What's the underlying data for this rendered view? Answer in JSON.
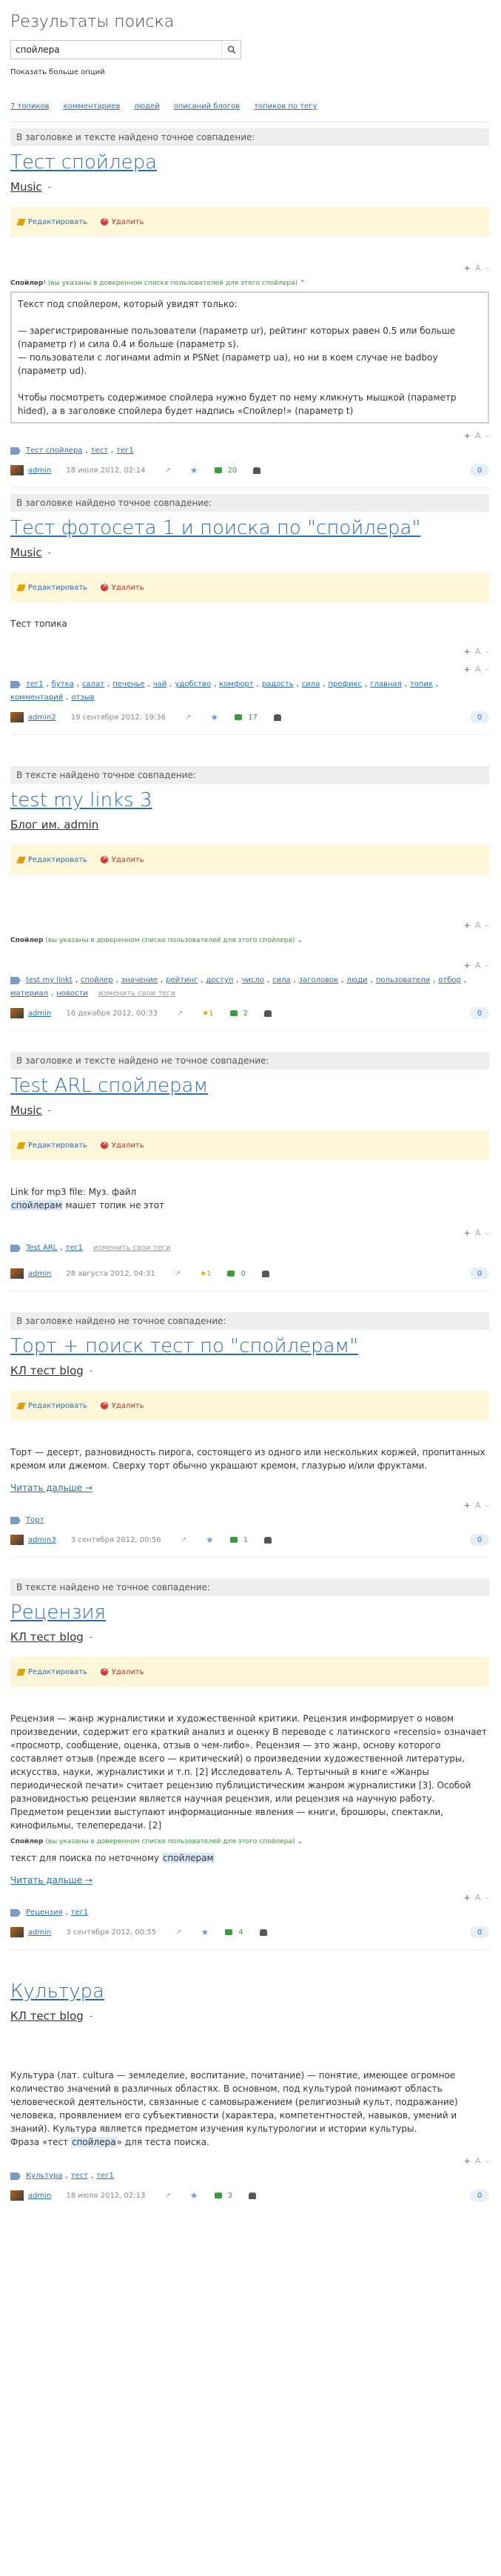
{
  "page": {
    "title": "Результаты поиска",
    "query": "спойлера",
    "more_options": "Показать больше опций",
    "filters": [
      "7 топиков",
      "комментариев",
      "людей",
      "описаний блогов",
      "топиков по тегу"
    ]
  },
  "topics": [
    {
      "match_note": "В заголовке и тексте найдено точное совпадение:",
      "title": "Тест спойлера",
      "blog": "Music",
      "edit": "Редактировать",
      "delete": "Удалить",
      "spoiler_note_prefix": "Спойлер",
      "spoiler_note_green": "(вы указаны в доверенном списке пользователей для этого спойлера)",
      "spoiler_lines": [
        "Текст под спойлером, который увидят только:",
        "— зарегистрированные пользователи (параметр ur), рейтинг которых равен 0.5 или больше (параметр r) и сила 0.4 и больше (параметр s).\n— пользователи с логинами admin и PSNet (параметр ua), но ни в коем случае не badboy (параметр ud).",
        "Чтобы посмотреть содержимое спойлера нужно будет по нему кликнуть мышкой (параметр hided), а в заголовке спойлера будет надпись «Спойлер!» (параметр t)"
      ],
      "tags": [
        "Тест спойлера",
        "тест",
        "тег1"
      ],
      "author": "admin",
      "date": "18 июля 2012, 02:14",
      "comments": "20",
      "rating": "0"
    },
    {
      "match_note": "В заголовке найдено точное совпадение:",
      "title": "Тест фотосета 1 и поиска по \"спойлера\"",
      "blog": "Music",
      "edit": "Редактировать",
      "delete": "Удалить",
      "body": "Тест топика",
      "tags": [
        "тег1",
        "бутка",
        "салат",
        "печенье",
        "чай",
        "удобство",
        "комфорт",
        "радость",
        "сила",
        "префикс",
        "главная",
        "топик",
        "комментарий",
        "отзыв"
      ],
      "author": "admin2",
      "date": "19 сентября 2012, 19:36",
      "comments": "17",
      "rating": "0"
    },
    {
      "match_note": "В тексте найдено точное совпадение:",
      "title": "test my links 3",
      "blog": "Блог им. admin",
      "edit": "Редактировать",
      "delete": "Удалить",
      "spoiler_note_prefix": "Спойлер",
      "spoiler_note_green": "(вы указаны в доверенном списке пользователей для этого спойлера)",
      "tags": [
        "test my linkt",
        "спойлер",
        "значение",
        "рейтинг",
        "доступ",
        "число",
        "сила",
        "заголовок",
        "люди",
        "пользователи",
        "отбор",
        "материал",
        "новости"
      ],
      "my_tags": "изменить свои теги",
      "author": "admin",
      "date": "16 декабря 2012, 00:33",
      "votes": "1",
      "comments": "2",
      "rating": "0"
    },
    {
      "match_note": "В заголовке и тексте найдено не точное совпадение:",
      "title": "Test ARL спойлерам",
      "blog": "Music",
      "edit": "Редактировать",
      "delete": "Удалить",
      "body_line1": "Link for mp3 file: Муз. файл",
      "body_hl": "спойлерам",
      "body_rest": " машет топик не этот",
      "tags": [
        "Test ARL",
        "тег1"
      ],
      "my_tags": "изменить свои теги",
      "author": "admin",
      "date": "28 августа 2012, 04:31",
      "votes": "1",
      "comments": "0",
      "rating": "0"
    },
    {
      "match_note": "В заголовке найдено не точное совпадение:",
      "title": "Торт + поиск тест по \"спойлерам\"",
      "blog": "КЛ тест blog",
      "edit": "Редактировать",
      "delete": "Удалить",
      "body": "Торт — десерт, разновидность пирога, состоящего из одного или нескольких коржей, пропитанных кремом или джемом. Сверху торт обычно украшают кремом, глазурью и/или фруктами.",
      "read_more": "Читать дальше →",
      "tags": [
        "Торт"
      ],
      "author": "admin3",
      "date": "3 сентября 2012, 00:56",
      "comments": "1",
      "rating": "0"
    },
    {
      "match_note": "В тексте найдено не точное совпадение:",
      "title": "Рецензия",
      "blog": "КЛ тест blog",
      "edit": "Редактировать",
      "delete": "Удалить",
      "body": "Рецензия — жанр журналистики и художественной критики. Рецензия информирует о новом произведении, содержит его краткий анализ и оценку В переводе с латинского «recensio» означает «просмотр, сообщение, оценка, отзыв о чем-либо». Рецензия — это жанр, основу которого составляет отзыв (прежде всего — критический) о произведении художественной литературы, искусства, науки, журналистики и т.п. [2] Исследователь А. Тертычный в книге «Жанры периодической печати» считает рецензию публицистическим жанром журналистики [3]. Особой разновидностью рецензии является научная рецензия, или рецензия на научную работу. Предметом рецензии выступают информационные явления — книги, брошюры, спектакли, кинофильмы, телепередачи. [2]",
      "spoiler_note_prefix": "Спойлер",
      "spoiler_note_green": "(вы указаны в доверенном списке пользователей для этого спойлера)",
      "body2_prefix": "текст для поиска по неточному ",
      "body2_hl": "спойлерам",
      "read_more": "Читать дальше →",
      "tags": [
        "Рецензия",
        "тег1"
      ],
      "author": "admin",
      "date": "3 сентября 2012, 00:55",
      "comments": "4",
      "rating": "0"
    },
    {
      "title": "Культура",
      "blog": "КЛ тест blog",
      "body": "Культура (лат. cultura — земледелие, воспитание, почитание) — понятие, имеющее огромное количество значений в различных областях. В основном, под культурой понимают область человеческой деятельности, связанные с самовыражением (религиозный культ, подражание) человека, проявлением его субъективности (характера, компетентностей, навыков, умений и знаний). Культура является предметом изучения культурологии и истории культуры.",
      "body2_prefix": "Фраза «тест ",
      "body2_hl": "спойлера",
      "body2_suffix": "» для теста поиска.",
      "tags": [
        "Культура",
        "тест",
        "тег1"
      ],
      "author": "admin",
      "date": "18 июля 2012, 02:13",
      "comments": "3",
      "rating": "0"
    }
  ]
}
